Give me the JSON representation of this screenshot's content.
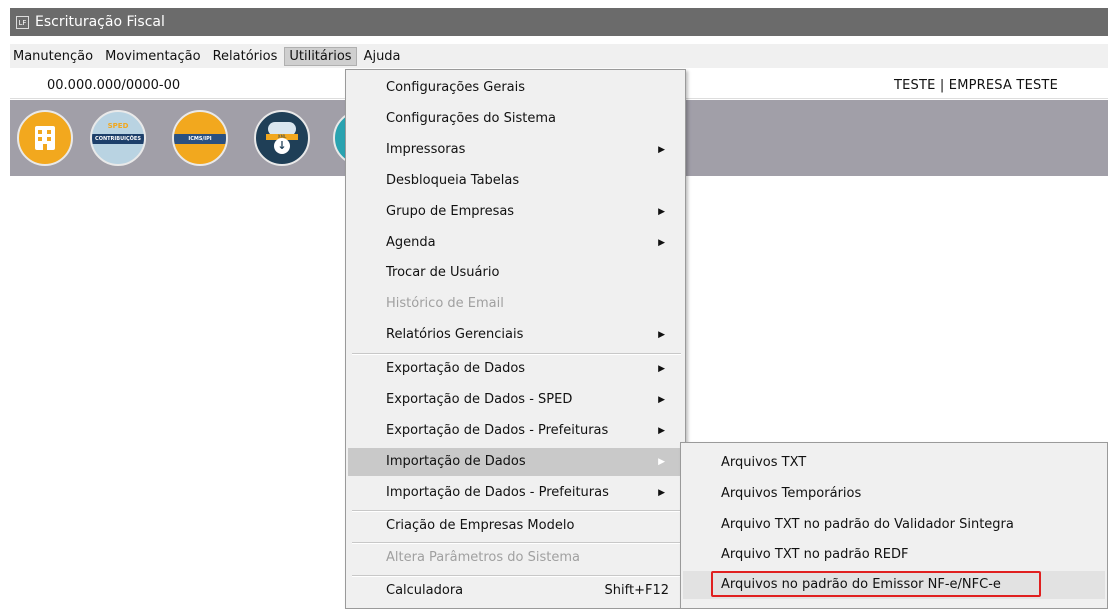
{
  "window": {
    "title": "Escrituração Fiscal",
    "app_icon": "LF"
  },
  "menubar": {
    "items": [
      {
        "label": "Manutenção"
      },
      {
        "label": "Movimentação"
      },
      {
        "label": "Relatórios"
      },
      {
        "label": "Utilitários"
      },
      {
        "label": "Ajuda"
      }
    ],
    "active": "Utilitários"
  },
  "infobar": {
    "cnpj": "00.000.000/0000-00",
    "empresa": "TESTE | EMPRESA TESTE"
  },
  "toolbar": {
    "buttons": [
      {
        "icon": "building-icon"
      },
      {
        "icon": "sped-contribuicoes-icon",
        "top_text": "SPED",
        "band_text": "CONTRIBUIÇÕES"
      },
      {
        "icon": "icms-ipi-icon",
        "band_text": "ICMS/IPI"
      },
      {
        "icon": "xml-cloud-download-icon",
        "band_text": "XML"
      },
      {
        "icon": "partial-icon"
      }
    ]
  },
  "utilitarios_menu": {
    "items": [
      {
        "label": "Configurações Gerais"
      },
      {
        "label": "Configurações do Sistema"
      },
      {
        "label": "Impressoras",
        "submenu": true
      },
      {
        "label": "Desbloqueia Tabelas"
      },
      {
        "label": "Grupo de Empresas",
        "submenu": true
      },
      {
        "label": "Agenda",
        "submenu": true
      },
      {
        "label": "Trocar de Usuário"
      },
      {
        "label": "Histórico de Email",
        "disabled": true
      },
      {
        "label": "Relatórios Gerenciais",
        "submenu": true
      },
      {
        "label": "Exportação de Dados",
        "submenu": true
      },
      {
        "label": "Exportação de Dados - SPED",
        "submenu": true
      },
      {
        "label": "Exportação de Dados - Prefeituras",
        "submenu": true
      },
      {
        "label": "Importação de Dados",
        "submenu": true,
        "highlighted": true
      },
      {
        "label": "Importação de Dados - Prefeituras",
        "submenu": true
      },
      {
        "label": "Criação de Empresas Modelo"
      },
      {
        "label": "Altera Parâmetros do Sistema",
        "disabled": true
      },
      {
        "label": "Calculadora",
        "shortcut": "Shift+F12"
      }
    ]
  },
  "importacao_submenu": {
    "items": [
      {
        "label": "Arquivos TXT"
      },
      {
        "label": "Arquivos Temporários"
      },
      {
        "label": "Arquivo TXT no padrão do Validador Sintegra"
      },
      {
        "label": "Arquivo TXT no padrão REDF"
      },
      {
        "label": "Arquivos no padrão do Emissor NF-e/NFC-e",
        "highlighted": true
      }
    ]
  },
  "colors": {
    "titlebar": "#6b6b6b",
    "toolbar": "#a19fa8",
    "highlight_box": "#e02020"
  }
}
